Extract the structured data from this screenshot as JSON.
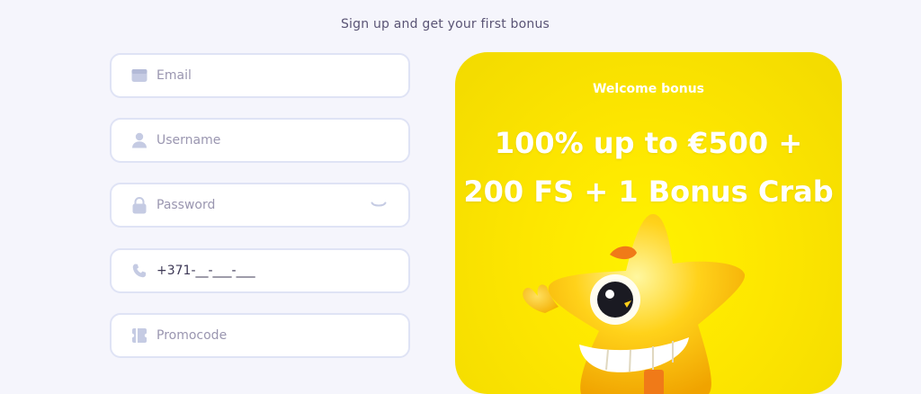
{
  "header": {
    "subtitle": "Sign up and get your first bonus"
  },
  "form": {
    "email": {
      "placeholder": "Email",
      "icon": "email-icon"
    },
    "username": {
      "placeholder": "Username",
      "icon": "user-icon"
    },
    "password": {
      "placeholder": "Password",
      "icon": "lock-icon",
      "toggle_icon": "eye-closed-icon"
    },
    "phone": {
      "value": "+371-__-___-___",
      "icon": "phone-icon"
    },
    "promocode": {
      "placeholder": "Promocode",
      "icon": "ticket-icon"
    }
  },
  "promo": {
    "label": "Welcome bonus",
    "headline_line1": "100% up to €500 +",
    "headline_line2": "200 FS + 1 Bonus Crab",
    "background": "#fde600",
    "text_color": "#ffffff"
  },
  "colors": {
    "page_bg": "#f5f5fc",
    "field_border": "#dfe3f5",
    "icon": "#c5cbe3",
    "placeholder": "#9a96b0"
  }
}
